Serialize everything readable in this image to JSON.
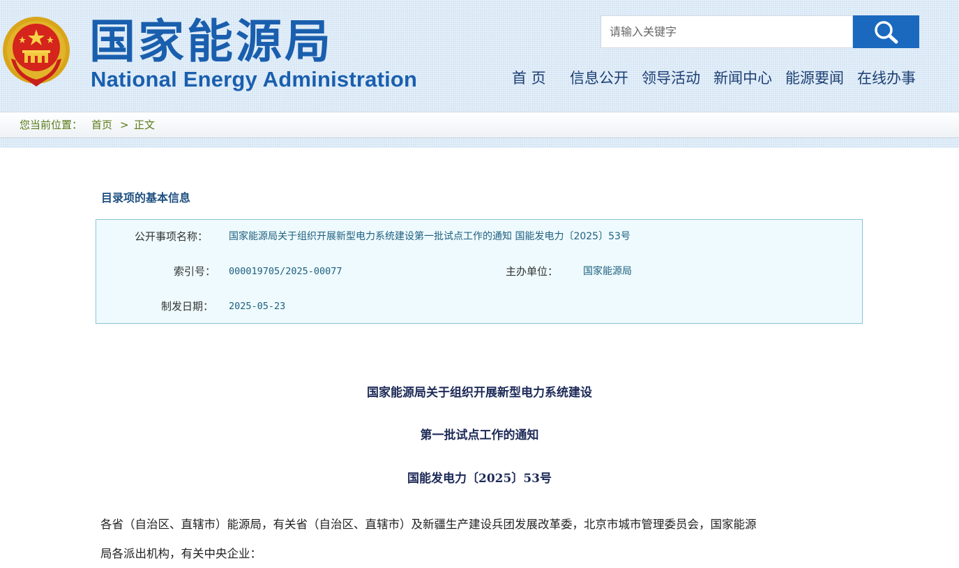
{
  "header": {
    "site_name_cn": "国家能源局",
    "site_name_en": "National Energy Administration",
    "emblem_icon": "national-emblem-icon",
    "brand_color": "#1a5fae"
  },
  "search": {
    "placeholder": "请输入关键字",
    "value": "",
    "button_icon": "search-icon",
    "button_color": "#1a69be"
  },
  "nav": {
    "items": [
      {
        "label": "首 页"
      },
      {
        "label": "信息公开"
      },
      {
        "label": "领导活动"
      },
      {
        "label": "新闻中心"
      },
      {
        "label": "能源要闻"
      },
      {
        "label": "在线办事"
      }
    ]
  },
  "breadcrumb": {
    "prefix": "您当前位置：",
    "home": "首页",
    "separator": ">",
    "current": "正文"
  },
  "info": {
    "section_title": "目录项的基本信息",
    "fields": {
      "name_label": "公开事项名称：",
      "name_value": "国家能源局关于组织开展新型电力系统建设第一批试点工作的通知 国能发电力〔2025〕53号",
      "index_label": "索引号：",
      "index_value": "000019705/2025-00077",
      "org_label": "主办单位：",
      "org_value": "国家能源局",
      "date_label": "制发日期：",
      "date_value": "2025-05-23"
    }
  },
  "article": {
    "title_line1": "国家能源局关于组织开展新型电力系统建设",
    "title_line2": "第一批试点工作的通知",
    "doc_number": "国能发电力〔2025〕53号",
    "body_line1": "各省（自治区、直辖市）能源局，有关省（自治区、直辖市）及新疆生产建设兵团发展改革委，北京市城市管理委员会，国家能源",
    "body_line2": "局各派出机构，有关中央企业："
  }
}
